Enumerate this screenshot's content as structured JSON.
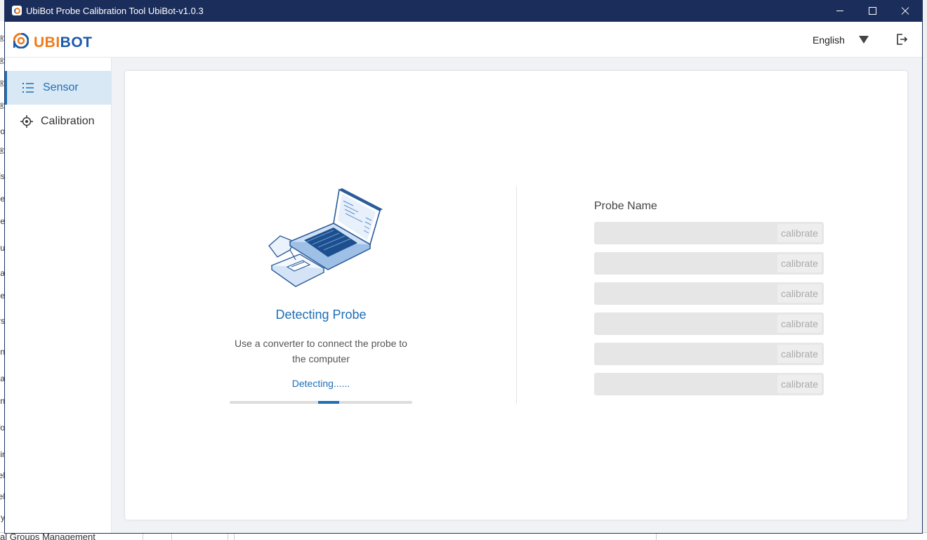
{
  "window": {
    "title": "UbiBot Probe Calibration Tool UbiBot-v1.0.3"
  },
  "header": {
    "logo_ubi": "UBI",
    "logo_bot": "BOT",
    "language": "English"
  },
  "sidebar": {
    "items": [
      {
        "label": "Sensor",
        "icon": "list-icon",
        "active": true
      },
      {
        "label": "Calibration",
        "icon": "crosshair-icon",
        "active": false
      }
    ]
  },
  "detect": {
    "title": "Detecting Probe",
    "description": "Use a converter to connect the probe to the computer",
    "status": "Detecting......",
    "progress": 0.12
  },
  "probes": {
    "label": "Probe Name",
    "rows": [
      {
        "value": "",
        "button": "calibrate"
      },
      {
        "value": "",
        "button": "calibrate"
      },
      {
        "value": "",
        "button": "calibrate"
      },
      {
        "value": "",
        "button": "calibrate"
      },
      {
        "value": "",
        "button": "calibrate"
      },
      {
        "value": "",
        "button": "calibrate"
      }
    ]
  },
  "background_app": {
    "bottom_text": "al Groups Management",
    "side_fragments": [
      "r",
      "®",
      "®",
      "®",
      "®",
      "o",
      "®",
      "ls",
      "e",
      "se",
      "ru",
      "a",
      "De",
      "rs",
      "n",
      "na",
      "n",
      "fo",
      "ir",
      "el",
      "el",
      "y"
    ]
  },
  "colors": {
    "titlebar": "#1b2d5a",
    "accent": "#1d6fb8",
    "brand_orange": "#f07a1a",
    "brand_blue": "#1d5aa8",
    "active_nav_bg": "#d9e8f5"
  }
}
